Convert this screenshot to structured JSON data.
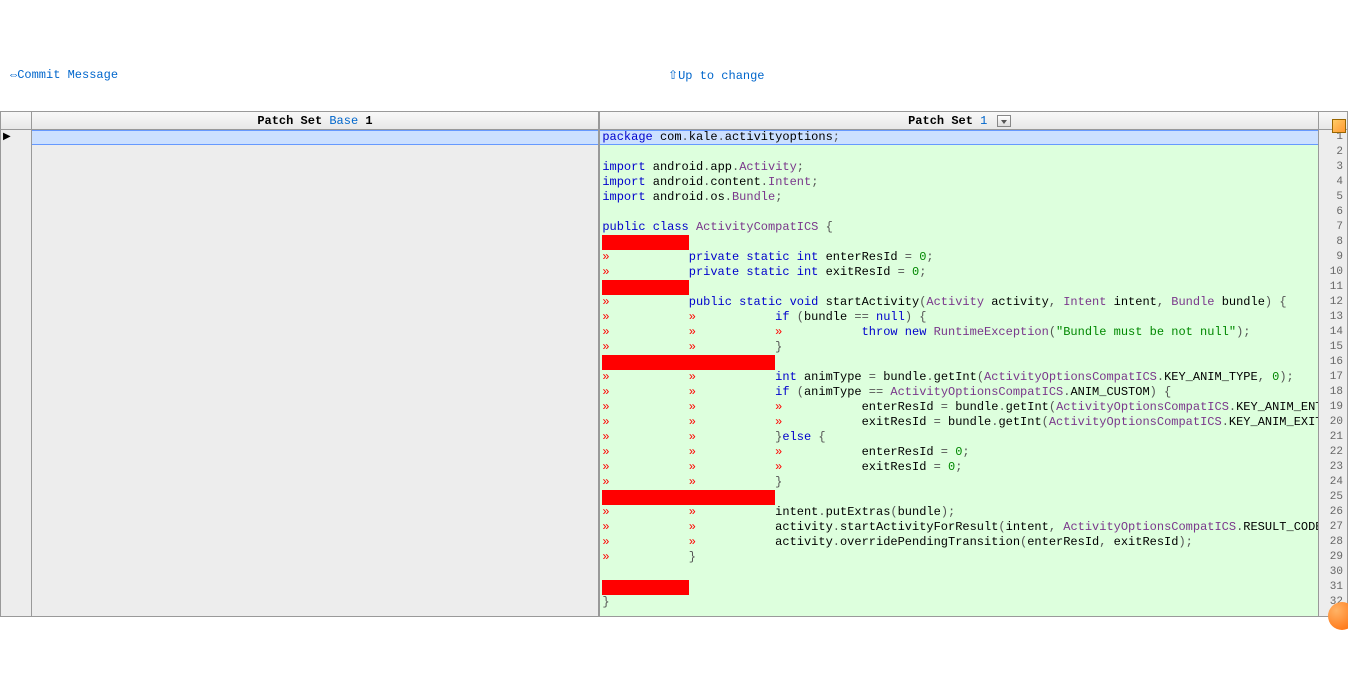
{
  "links": {
    "commit_message": "⇔Commit Message",
    "up_to_change": "⇧Up to change"
  },
  "headers": {
    "left_prefix": "Patch Set ",
    "left_link": "Base",
    "left_suffix": " 1",
    "right_prefix": "Patch Set ",
    "right_link": "1"
  },
  "code": {
    "lines": [
      {
        "n": 1,
        "sel": true,
        "tokens": [
          {
            "t": "package ",
            "c": "kw"
          },
          {
            "t": "com",
            "c": "ident"
          },
          {
            "t": ".",
            "c": "punct"
          },
          {
            "t": "kale",
            "c": "ident"
          },
          {
            "t": ".",
            "c": "punct"
          },
          {
            "t": "activityoptions",
            "c": "ident"
          },
          {
            "t": ";",
            "c": "punct"
          }
        ]
      },
      {
        "n": 2,
        "tokens": []
      },
      {
        "n": 3,
        "tokens": [
          {
            "t": "import ",
            "c": "kw"
          },
          {
            "t": "android",
            "c": "ident"
          },
          {
            "t": ".",
            "c": "punct"
          },
          {
            "t": "app",
            "c": "ident"
          },
          {
            "t": ".",
            "c": "punct"
          },
          {
            "t": "Activity",
            "c": "type"
          },
          {
            "t": ";",
            "c": "punct"
          }
        ]
      },
      {
        "n": 4,
        "tokens": [
          {
            "t": "import ",
            "c": "kw"
          },
          {
            "t": "android",
            "c": "ident"
          },
          {
            "t": ".",
            "c": "punct"
          },
          {
            "t": "content",
            "c": "ident"
          },
          {
            "t": ".",
            "c": "punct"
          },
          {
            "t": "Intent",
            "c": "type"
          },
          {
            "t": ";",
            "c": "punct"
          }
        ]
      },
      {
        "n": 5,
        "tokens": [
          {
            "t": "import ",
            "c": "kw"
          },
          {
            "t": "android",
            "c": "ident"
          },
          {
            "t": ".",
            "c": "punct"
          },
          {
            "t": "os",
            "c": "ident"
          },
          {
            "t": ".",
            "c": "punct"
          },
          {
            "t": "Bundle",
            "c": "type"
          },
          {
            "t": ";",
            "c": "punct"
          }
        ]
      },
      {
        "n": 6,
        "tokens": []
      },
      {
        "n": 7,
        "tokens": [
          {
            "t": "public class ",
            "c": "kw"
          },
          {
            "t": "ActivityCompatICS",
            "c": "type"
          },
          {
            "t": " {",
            "c": "punct"
          }
        ]
      },
      {
        "n": 8,
        "ws": 1,
        "tokens": []
      },
      {
        "n": 9,
        "tabs": 1,
        "tokens": [
          {
            "t": "private static int ",
            "c": "kw"
          },
          {
            "t": "enterResId",
            "c": "ident"
          },
          {
            "t": " = ",
            "c": "punct"
          },
          {
            "t": "0",
            "c": "num"
          },
          {
            "t": ";",
            "c": "punct"
          }
        ]
      },
      {
        "n": 10,
        "tabs": 1,
        "tokens": [
          {
            "t": "private static int ",
            "c": "kw"
          },
          {
            "t": "exitResId",
            "c": "ident"
          },
          {
            "t": " = ",
            "c": "punct"
          },
          {
            "t": "0",
            "c": "num"
          },
          {
            "t": ";",
            "c": "punct"
          }
        ]
      },
      {
        "n": 11,
        "ws": 1,
        "tokens": []
      },
      {
        "n": 12,
        "tabs": 1,
        "tokens": [
          {
            "t": "public static void ",
            "c": "kw"
          },
          {
            "t": "startActivity",
            "c": "ident"
          },
          {
            "t": "(",
            "c": "punct"
          },
          {
            "t": "Activity",
            "c": "type"
          },
          {
            "t": " activity",
            "c": "ident"
          },
          {
            "t": ", ",
            "c": "punct"
          },
          {
            "t": "Intent",
            "c": "type"
          },
          {
            "t": " intent",
            "c": "ident"
          },
          {
            "t": ", ",
            "c": "punct"
          },
          {
            "t": "Bundle",
            "c": "type"
          },
          {
            "t": " bundle",
            "c": "ident"
          },
          {
            "t": ") {",
            "c": "punct"
          }
        ]
      },
      {
        "n": 13,
        "tabs": 2,
        "tokens": [
          {
            "t": "if ",
            "c": "kw"
          },
          {
            "t": "(",
            "c": "punct"
          },
          {
            "t": "bundle",
            "c": "ident"
          },
          {
            "t": " == ",
            "c": "punct"
          },
          {
            "t": "null",
            "c": "kw"
          },
          {
            "t": ") {",
            "c": "punct"
          }
        ]
      },
      {
        "n": 14,
        "tabs": 3,
        "tokens": [
          {
            "t": "throw new ",
            "c": "kw"
          },
          {
            "t": "RuntimeException",
            "c": "type"
          },
          {
            "t": "(",
            "c": "punct"
          },
          {
            "t": "\"Bundle must be not null\"",
            "c": "str"
          },
          {
            "t": ");",
            "c": "punct"
          }
        ]
      },
      {
        "n": 15,
        "tabs": 2,
        "tokens": [
          {
            "t": "}",
            "c": "punct"
          }
        ]
      },
      {
        "n": 16,
        "ws": 2,
        "tokens": []
      },
      {
        "n": 17,
        "tabs": 2,
        "tokens": [
          {
            "t": "int ",
            "c": "kw"
          },
          {
            "t": "animType",
            "c": "ident"
          },
          {
            "t": " = ",
            "c": "punct"
          },
          {
            "t": "bundle",
            "c": "ident"
          },
          {
            "t": ".",
            "c": "punct"
          },
          {
            "t": "getInt",
            "c": "ident"
          },
          {
            "t": "(",
            "c": "punct"
          },
          {
            "t": "ActivityOptionsCompatICS",
            "c": "type"
          },
          {
            "t": ".",
            "c": "punct"
          },
          {
            "t": "KEY_ANIM_TYPE",
            "c": "ident"
          },
          {
            "t": ", ",
            "c": "punct"
          },
          {
            "t": "0",
            "c": "num"
          },
          {
            "t": ");",
            "c": "punct"
          }
        ]
      },
      {
        "n": 18,
        "tabs": 2,
        "tokens": [
          {
            "t": "if ",
            "c": "kw"
          },
          {
            "t": "(",
            "c": "punct"
          },
          {
            "t": "animType",
            "c": "ident"
          },
          {
            "t": " == ",
            "c": "punct"
          },
          {
            "t": "ActivityOptionsCompatICS",
            "c": "type"
          },
          {
            "t": ".",
            "c": "punct"
          },
          {
            "t": "ANIM_CUSTOM",
            "c": "ident"
          },
          {
            "t": ") {",
            "c": "punct"
          }
        ]
      },
      {
        "n": 19,
        "tabs": 3,
        "tokens": [
          {
            "t": "enterResId",
            "c": "ident"
          },
          {
            "t": " = ",
            "c": "punct"
          },
          {
            "t": "bundle",
            "c": "ident"
          },
          {
            "t": ".",
            "c": "punct"
          },
          {
            "t": "getInt",
            "c": "ident"
          },
          {
            "t": "(",
            "c": "punct"
          },
          {
            "t": "ActivityOptionsCompatICS",
            "c": "type"
          },
          {
            "t": ".",
            "c": "punct"
          },
          {
            "t": "KEY_ANIM_ENTER_RES_ID",
            "c": "ident"
          },
          {
            "t": ");",
            "c": "punct"
          }
        ]
      },
      {
        "n": 20,
        "tabs": 3,
        "tokens": [
          {
            "t": "exitResId",
            "c": "ident"
          },
          {
            "t": " = ",
            "c": "punct"
          },
          {
            "t": "bundle",
            "c": "ident"
          },
          {
            "t": ".",
            "c": "punct"
          },
          {
            "t": "getInt",
            "c": "ident"
          },
          {
            "t": "(",
            "c": "punct"
          },
          {
            "t": "ActivityOptionsCompatICS",
            "c": "type"
          },
          {
            "t": ".",
            "c": "punct"
          },
          {
            "t": "KEY_ANIM_EXIT_RES_ID",
            "c": "ident"
          },
          {
            "t": ");",
            "c": "punct"
          }
        ]
      },
      {
        "n": 21,
        "tabs": 2,
        "tokens": [
          {
            "t": "}",
            "c": "punct"
          },
          {
            "t": "else ",
            "c": "kw"
          },
          {
            "t": "{",
            "c": "punct"
          }
        ]
      },
      {
        "n": 22,
        "tabs": 3,
        "tokens": [
          {
            "t": "enterResId",
            "c": "ident"
          },
          {
            "t": " = ",
            "c": "punct"
          },
          {
            "t": "0",
            "c": "num"
          },
          {
            "t": ";",
            "c": "punct"
          }
        ]
      },
      {
        "n": 23,
        "tabs": 3,
        "tokens": [
          {
            "t": "exitResId",
            "c": "ident"
          },
          {
            "t": " = ",
            "c": "punct"
          },
          {
            "t": "0",
            "c": "num"
          },
          {
            "t": ";",
            "c": "punct"
          }
        ]
      },
      {
        "n": 24,
        "tabs": 2,
        "tokens": [
          {
            "t": "}",
            "c": "punct"
          }
        ]
      },
      {
        "n": 25,
        "ws": 2,
        "tokens": []
      },
      {
        "n": 26,
        "tabs": 2,
        "tokens": [
          {
            "t": "intent",
            "c": "ident"
          },
          {
            "t": ".",
            "c": "punct"
          },
          {
            "t": "putExtras",
            "c": "ident"
          },
          {
            "t": "(",
            "c": "punct"
          },
          {
            "t": "bundle",
            "c": "ident"
          },
          {
            "t": ");",
            "c": "punct"
          }
        ]
      },
      {
        "n": 27,
        "tabs": 2,
        "tokens": [
          {
            "t": "activity",
            "c": "ident"
          },
          {
            "t": ".",
            "c": "punct"
          },
          {
            "t": "startActivityForResult",
            "c": "ident"
          },
          {
            "t": "(",
            "c": "punct"
          },
          {
            "t": "intent",
            "c": "ident"
          },
          {
            "t": ", ",
            "c": "punct"
          },
          {
            "t": "ActivityOptionsCompatICS",
            "c": "type"
          },
          {
            "t": ".",
            "c": "punct"
          },
          {
            "t": "RESULT_CODE",
            "c": "ident"
          },
          {
            "t": ");",
            "c": "punct"
          }
        ]
      },
      {
        "n": 28,
        "tabs": 2,
        "tokens": [
          {
            "t": "activity",
            "c": "ident"
          },
          {
            "t": ".",
            "c": "punct"
          },
          {
            "t": "overridePendingTransition",
            "c": "ident"
          },
          {
            "t": "(",
            "c": "punct"
          },
          {
            "t": "enterResId",
            "c": "ident"
          },
          {
            "t": ", ",
            "c": "punct"
          },
          {
            "t": "exitResId",
            "c": "ident"
          },
          {
            "t": ");",
            "c": "punct"
          }
        ]
      },
      {
        "n": 29,
        "tabs": 1,
        "tokens": [
          {
            "t": "}",
            "c": "punct"
          }
        ]
      },
      {
        "n": 30,
        "tokens": []
      },
      {
        "n": 31,
        "ws": 1,
        "tokens": []
      },
      {
        "n": 32,
        "tokens": [
          {
            "t": "}",
            "c": "punct"
          }
        ]
      }
    ]
  },
  "marker": "▶"
}
